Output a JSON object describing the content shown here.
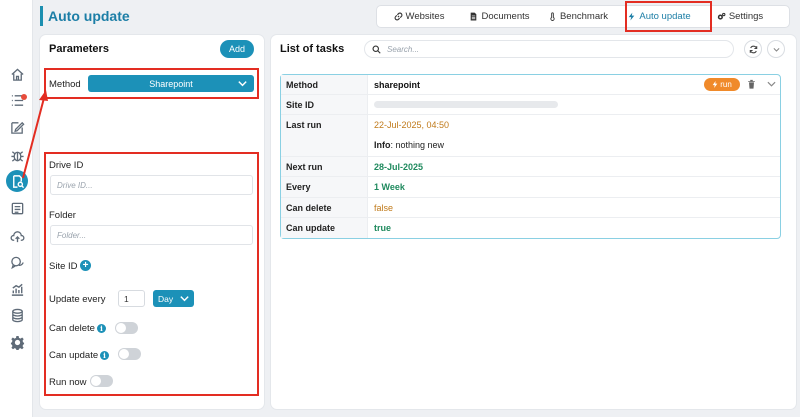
{
  "header": {
    "title": "Auto update"
  },
  "tabs": [
    {
      "label": "Websites",
      "icon": "link-icon"
    },
    {
      "label": "Documents",
      "icon": "document-icon"
    },
    {
      "label": "Benchmark",
      "icon": "thermometer-icon"
    },
    {
      "label": "Auto update",
      "icon": "lightning-icon"
    },
    {
      "label": "Settings",
      "icon": "gears-icon"
    }
  ],
  "nav_icons": [
    "home-icon",
    "list-icon",
    "edit-icon",
    "bug-icon",
    "document-search-icon",
    "form-icon",
    "cloud-upload-icon",
    "chat-icon",
    "analytics-icon",
    "database-icon",
    "settings-icon"
  ],
  "parameters": {
    "title": "Parameters",
    "add_label": "Add",
    "method_label": "Method",
    "method_value": "Sharepoint",
    "drive_id_label": "Drive ID",
    "drive_id_placeholder": "Drive ID...",
    "folder_label": "Folder",
    "folder_placeholder": "Folder...",
    "site_id_label": "Site ID",
    "update_every_label": "Update every",
    "update_every_value": "1",
    "period_value": "Day",
    "can_delete_label": "Can delete",
    "can_update_label": "Can update",
    "run_now_label": "Run now"
  },
  "tasks": {
    "title": "List of tasks",
    "search_placeholder": "Search...",
    "run_label": "run",
    "rows": {
      "method": {
        "key": "Method",
        "value": "sharepoint"
      },
      "site_id": {
        "key": "Site ID"
      },
      "last_run": {
        "key": "Last run",
        "value": "22-Jul-2025, 04:50",
        "info_label": "Info",
        "info_value": ": nothing new"
      },
      "next_run": {
        "key": "Next run",
        "value": "28-Jul-2025"
      },
      "every": {
        "key": "Every",
        "value": "1 Week"
      },
      "can_delete": {
        "key": "Can delete",
        "value": "false"
      },
      "can_update": {
        "key": "Can update",
        "value": "true"
      }
    }
  },
  "colors": {
    "accent": "#1c91b8",
    "highlight": "#e32d22",
    "run": "#f08a2a",
    "green": "#1f8a5e",
    "orange": "#c07a1a"
  }
}
